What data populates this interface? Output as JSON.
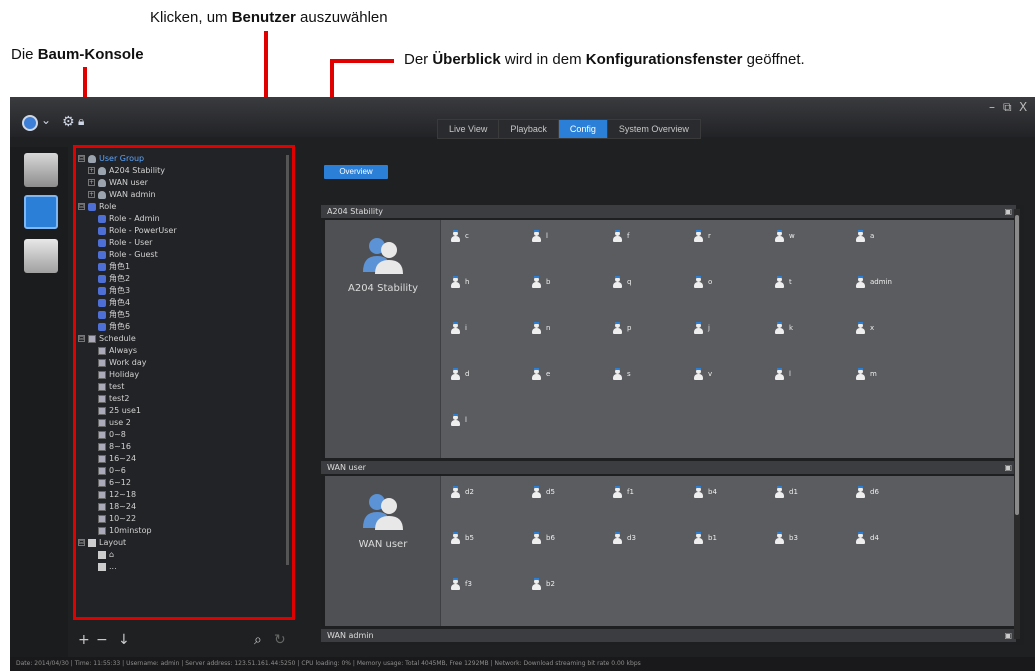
{
  "annotations": {
    "user_select_prefix": "Klicken, um ",
    "user_select_bold": "Benutzer",
    "user_select_suffix": " auszuwählen",
    "tree_prefix": "Die ",
    "tree_bold": "Baum-Konsole",
    "overview_prefix": "Der ",
    "overview_bold1": "Überblick",
    "overview_mid": " wird in dem ",
    "overview_bold2": "Konfigurationsfenster",
    "overview_suffix": " geöffnet.",
    "accent_color": "#e00000"
  },
  "window": {
    "controls": {
      "minimize": "–",
      "restore": "⧉",
      "close": "X"
    }
  },
  "tabs": [
    {
      "label": "Live View"
    },
    {
      "label": "Playback"
    },
    {
      "label": "Config",
      "active": true
    },
    {
      "label": "System Overview"
    }
  ],
  "tree": {
    "user_group": {
      "label": "User Group",
      "expand": "⊟"
    },
    "groups": [
      {
        "label": "A204 Stability"
      },
      {
        "label": "WAN user"
      },
      {
        "label": "WAN admin"
      }
    ],
    "role": {
      "label": "Role",
      "expand": "⊟"
    },
    "roles": [
      {
        "label": "Role - Admin"
      },
      {
        "label": "Role - PowerUser"
      },
      {
        "label": "Role - User"
      },
      {
        "label": "Role - Guest"
      },
      {
        "label": "角色1"
      },
      {
        "label": "角色2"
      },
      {
        "label": "角色3"
      },
      {
        "label": "角色4"
      },
      {
        "label": "角色5"
      },
      {
        "label": "角色6"
      }
    ],
    "schedule": {
      "label": "Schedule",
      "expand": "⊟"
    },
    "schedules": [
      {
        "label": "Always"
      },
      {
        "label": "Work day"
      },
      {
        "label": "Holiday"
      },
      {
        "label": "test"
      },
      {
        "label": "test2"
      },
      {
        "label": "25 use1"
      },
      {
        "label": "use 2"
      },
      {
        "label": "0~8"
      },
      {
        "label": "8~16"
      },
      {
        "label": "16~24"
      },
      {
        "label": "0~6"
      },
      {
        "label": "6~12"
      },
      {
        "label": "12~18"
      },
      {
        "label": "18~24"
      },
      {
        "label": "10~22"
      },
      {
        "label": "10minstop"
      }
    ],
    "layout": {
      "label": "Layout",
      "expand": "⊟"
    },
    "layouts": [
      {
        "label": "⌂"
      },
      {
        "label": "..."
      }
    ],
    "toolbar": {
      "add": "+",
      "remove": "−",
      "sort": "↓",
      "search": "⌕",
      "refresh": "↻"
    }
  },
  "overview_button": {
    "label": "Overview"
  },
  "panels": [
    {
      "title": "A204 Stability",
      "group_label": "A204 Stability",
      "users": [
        "c",
        "l",
        "f",
        "r",
        "w",
        "a",
        "h",
        "b",
        "q",
        "o",
        "t",
        "admin",
        "i",
        "n",
        "p",
        "j",
        "k",
        "x",
        "d",
        "e",
        "s",
        "v",
        "l",
        "m",
        "l"
      ]
    },
    {
      "title": "WAN user",
      "group_label": "WAN user",
      "users": [
        "d2",
        "d5",
        "f1",
        "b4",
        "d1",
        "d6",
        "b5",
        "b6",
        "d3",
        "b1",
        "b3",
        "d4",
        "f3",
        "b2"
      ]
    },
    {
      "title": "WAN admin",
      "group_label": "",
      "users": []
    }
  ],
  "status_bar": {
    "text": "Date: 2014/04/30  |  Time: 11:55:33  |  Username: admin  |  Server address: 123.51.161.44:5250  |  CPU loading: 0%  |  Memory usage: Total 4045MB, Free 1292MB  |  Network: Download streaming bit rate    0.00 kbps"
  }
}
